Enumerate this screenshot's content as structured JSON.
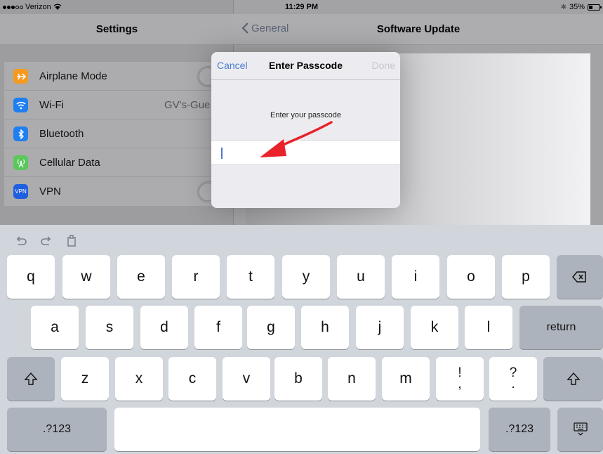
{
  "status_bar": {
    "carrier": "Verizon",
    "time": "11:29 PM",
    "battery": "35%",
    "battery_level": 0.35
  },
  "master": {
    "title": "Settings",
    "items": [
      {
        "label": "Airplane Mode",
        "icon": "airplane-icon",
        "color": "#f59a1f",
        "control": "toggle"
      },
      {
        "label": "Wi-Fi",
        "value": "GV's-Gue",
        "icon": "wifi-icon",
        "color": "#1f7ef0"
      },
      {
        "label": "Bluetooth",
        "icon": "bluetooth-icon",
        "color": "#1f7ef0"
      },
      {
        "label": "Cellular Data",
        "icon": "cellular-icon",
        "color": "#5ac85a"
      },
      {
        "label": "VPN",
        "icon": "vpn-icon",
        "color": "#1f5fe0",
        "control": "toggle"
      }
    ]
  },
  "detail": {
    "back_label": "General",
    "title": "Software Update"
  },
  "modal": {
    "cancel_label": "Cancel",
    "title": "Enter Passcode",
    "done_label": "Done",
    "prompt": "Enter your passcode",
    "field_value": ""
  },
  "keyboard": {
    "row1": [
      "q",
      "w",
      "e",
      "r",
      "t",
      "y",
      "u",
      "i",
      "o",
      "p"
    ],
    "row2": [
      "a",
      "s",
      "d",
      "f",
      "g",
      "h",
      "j",
      "k",
      "l"
    ],
    "row3": [
      "z",
      "x",
      "c",
      "v",
      "b",
      "n",
      "m"
    ],
    "punct1": {
      "top": "!",
      "bottom": ","
    },
    "punct2": {
      "top": "?",
      "bottom": "."
    },
    "return_label": "return",
    "numbers_left": ".?123",
    "numbers_right": ".?123"
  },
  "colors": {
    "accent": "#4a7bd0",
    "arrow": "#e8232a"
  }
}
